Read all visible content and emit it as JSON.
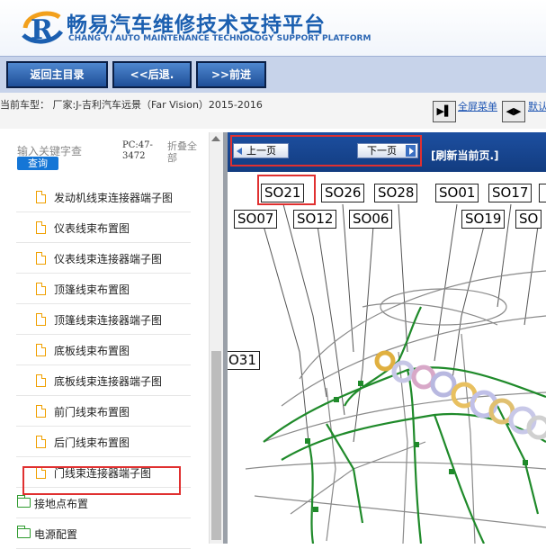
{
  "header": {
    "title": "畅易汽车维修技术支持平台",
    "subtitle": "CHANG YI AUTO MAINTENANCE TECHNOLOGY SUPPORT PLATFORM",
    "logo_letter": "R"
  },
  "nav": {
    "home": "返回主目录",
    "back": "<<后退.",
    "forward": ">>前进"
  },
  "model_bar": {
    "text": "当前车型： 厂家:J-吉利汽车远景（Far Vision）2015-2016",
    "fullscreen_label": "全屏菜单",
    "default_view_label": "默认视图"
  },
  "sidebar": {
    "search_label": "输入关键字查",
    "search_button": "查询",
    "pc_code": "PC:47-3472",
    "collapse_all": "折叠全部",
    "items": [
      {
        "label": "发动机线束连接器端子图",
        "type": "file"
      },
      {
        "label": "仪表线束布置图",
        "type": "file"
      },
      {
        "label": "仪表线束连接器端子图",
        "type": "file"
      },
      {
        "label": "顶篷线束布置图",
        "type": "file"
      },
      {
        "label": "顶篷线束连接器端子图",
        "type": "file"
      },
      {
        "label": "底板线束布置图",
        "type": "file",
        "selected": true
      },
      {
        "label": "底板线束连接器端子图",
        "type": "file"
      },
      {
        "label": "前门线束布置图",
        "type": "file"
      },
      {
        "label": "后门线束布置图",
        "type": "file"
      },
      {
        "label": "门线束连接器端子图",
        "type": "file"
      },
      {
        "label": "接地点布置",
        "type": "folder"
      },
      {
        "label": "电源配置",
        "type": "folder"
      }
    ]
  },
  "diagram_pane": {
    "prev_page": "上一页",
    "next_page": "下一页",
    "refresh": "[刷新当前页.]",
    "connectors_row1": [
      "SO21",
      "SO26",
      "SO28",
      "SO01",
      "SO17"
    ],
    "connectors_row2": [
      "SO07",
      "SO12",
      "SO06",
      "SO19",
      "SO"
    ],
    "connector_left": "O31"
  },
  "colors": {
    "brand_blue": "#1b5fb0",
    "nav_bg": "#c7d3ea",
    "toolbar_blue": "#1d4fa0",
    "highlight_red": "#e03030"
  }
}
